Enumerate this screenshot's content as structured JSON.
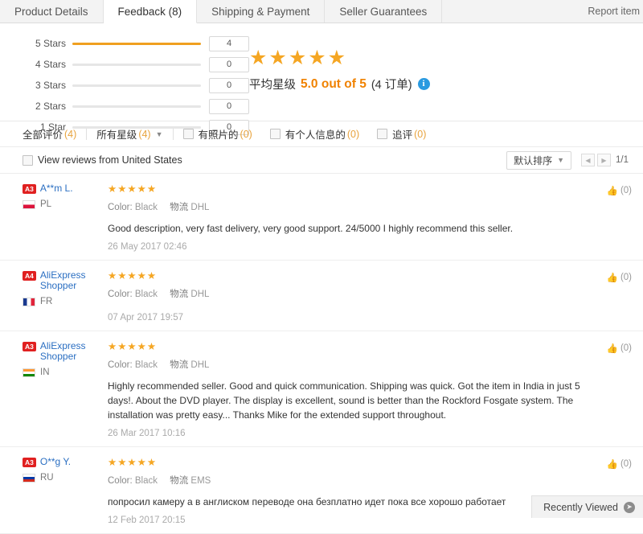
{
  "tabs": [
    {
      "label": "Product Details",
      "active": false
    },
    {
      "label": "Feedback (8)",
      "active": true
    },
    {
      "label": "Shipping & Payment",
      "active": false
    },
    {
      "label": "Seller Guarantees",
      "active": false
    }
  ],
  "report_item": "Report item",
  "summary": {
    "bars": [
      {
        "label": "5 Stars",
        "count": "4",
        "percent": 100
      },
      {
        "label": "4 Stars",
        "count": "0",
        "percent": 0
      },
      {
        "label": "3 Stars",
        "count": "0",
        "percent": 0
      },
      {
        "label": "2 Stars",
        "count": "0",
        "percent": 0
      },
      {
        "label": "1 Star",
        "count": "0",
        "percent": 0
      }
    ],
    "stars_glyph": "★★★★★",
    "avg_label": "平均星级",
    "avg_score": "5.0 out of 5",
    "orders": "(4 订单)",
    "info_glyph": "i",
    "accent_color": "#f0a020",
    "score_color": "#f08200"
  },
  "filters": {
    "all_reviews": "全部评价",
    "all_reviews_count": "(4)",
    "all_stars": "所有星级",
    "all_stars_count": "(4)",
    "with_photos": "有照片的",
    "with_photos_count": "(0)",
    "with_personal": "有个人信息的",
    "with_personal_count": "(0)",
    "additional": "追评",
    "additional_count": "(0)"
  },
  "viewrow": {
    "view_from": "View reviews from United States",
    "sort_label": "默认排序",
    "page_text": "1/1",
    "prev_glyph": "◀",
    "next_glyph": "▶"
  },
  "reviews": [
    {
      "level": "A3",
      "name": "A**m L.",
      "country": "PL",
      "flag_class": "flag-pl",
      "stars": "★★★★★",
      "color_key": "Color:",
      "color_value": "Black",
      "logistics_label": "物流",
      "logistics_value": "DHL",
      "text": "Good description, very fast delivery, very good support. 24/5000 I highly recommend this seller.",
      "date": "26 May 2017 02:46",
      "helpful": "(0)"
    },
    {
      "level": "A4",
      "name": "AliExpress Shopper",
      "country": "FR",
      "flag_class": "flag-fr",
      "stars": "★★★★★",
      "color_key": "Color:",
      "color_value": "Black",
      "logistics_label": "物流",
      "logistics_value": "DHL",
      "text": "",
      "date": "07 Apr 2017 19:57",
      "helpful": "(0)"
    },
    {
      "level": "A3",
      "name": "AliExpress Shopper",
      "country": "IN",
      "flag_class": "flag-in",
      "stars": "★★★★★",
      "color_key": "Color:",
      "color_value": "Black",
      "logistics_label": "物流",
      "logistics_value": "DHL",
      "text": "Highly recommended seller. Good and quick communication. Shipping was quick. Got the item in India in just 5 days!. About the DVD player. The display is excellent, sound is better than the Rockford Fosgate system. The installation was pretty easy... Thanks Mike for the extended support throughout.",
      "date": "26 Mar 2017 10:16",
      "helpful": "(0)"
    },
    {
      "level": "A3",
      "name": "O**g Y.",
      "country": "RU",
      "flag_class": "flag-ru",
      "stars": "★★★★★",
      "color_key": "Color:",
      "color_value": "Black",
      "logistics_label": "物流",
      "logistics_value": "EMS",
      "text": "попросил камеру а в англиском переводе она безплатно идет пока все хорошо работает",
      "date": "12 Feb 2017 20:15",
      "helpful": "(0)"
    }
  ],
  "recently_viewed": {
    "label": "Recently Viewed",
    "arrow_glyph": "➤"
  }
}
